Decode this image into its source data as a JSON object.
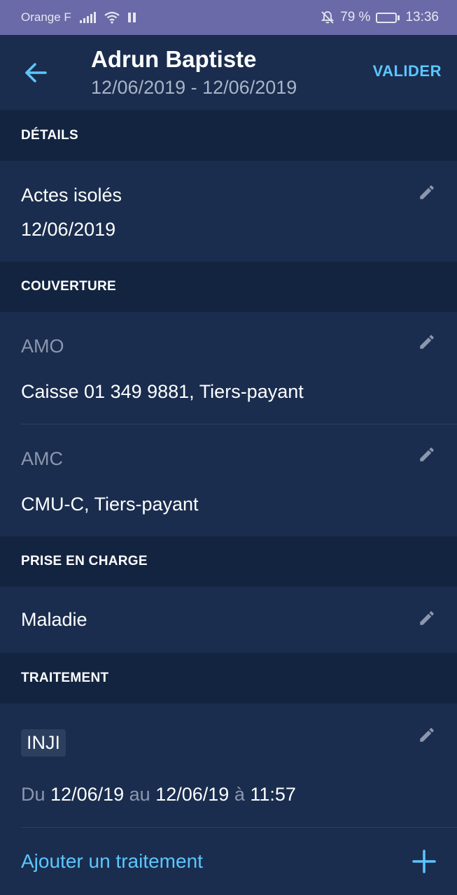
{
  "status_bar": {
    "carrier": "Orange F",
    "battery": "79 %",
    "battery_level": 0.79,
    "time": "13:36"
  },
  "appbar": {
    "title": "Adrun Baptiste",
    "subtitle": "12/06/2019 - 12/06/2019",
    "action": "VALIDER"
  },
  "details": {
    "header": "DÉTAILS",
    "line1": "Actes isolés",
    "line2": "12/06/2019"
  },
  "couverture": {
    "header": "COUVERTURE",
    "amo_label": "AMO",
    "amo_value": "Caisse 01 349 9881, Tiers-payant",
    "amc_label": "AMC",
    "amc_value": "CMU-C, Tiers-payant"
  },
  "prise": {
    "header": "PRISE EN CHARGE",
    "value": "Maladie"
  },
  "traitement": {
    "header": "TRAITEMENT",
    "code": "INJI",
    "du": "Du",
    "start": "12/06/19",
    "au": "au",
    "end": "12/06/19",
    "a": "à",
    "time": "11:57",
    "add_label": "Ajouter un traitement"
  },
  "colors": {
    "accent": "#5cc6ff",
    "background": "#1a2d4e",
    "section_header": "#132440",
    "status_bar": "#6b6aa8"
  }
}
